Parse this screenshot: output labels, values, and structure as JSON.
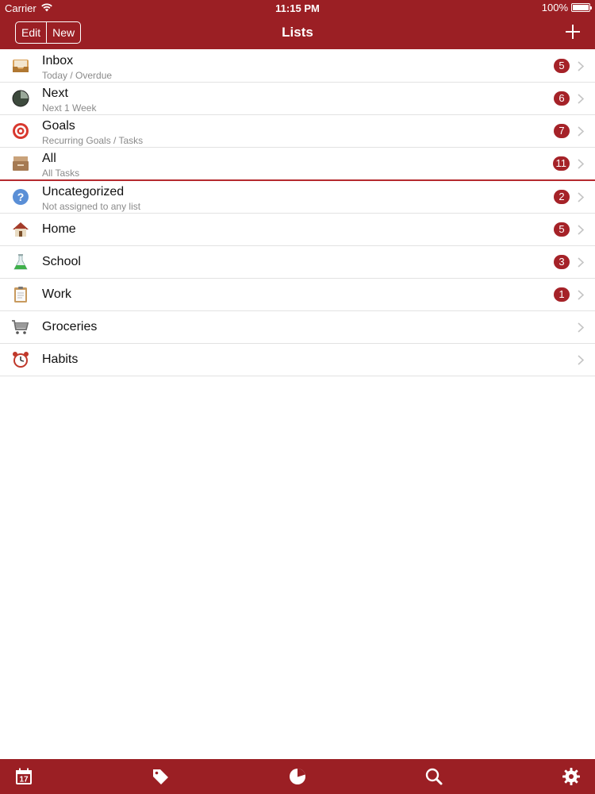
{
  "status_bar": {
    "carrier": "Carrier",
    "time": "11:15 PM",
    "battery": "100%"
  },
  "nav": {
    "edit_label": "Edit",
    "new_label": "New",
    "title": "Lists",
    "add_icon": "plus-icon"
  },
  "lists": [
    {
      "title": "Inbox",
      "subtitle": "Today / Overdue",
      "badge": "5",
      "icon": "inbox-tray-icon"
    },
    {
      "title": "Next",
      "subtitle": "Next 1 Week",
      "badge": "6",
      "icon": "clock-pie-icon"
    },
    {
      "title": "Goals",
      "subtitle": "Recurring Goals / Tasks",
      "badge": "7",
      "icon": "target-icon"
    },
    {
      "title": "All",
      "subtitle": "All Tasks",
      "badge": "11",
      "icon": "archive-box-icon"
    },
    {
      "title": "Uncategorized",
      "subtitle": "Not assigned to any list",
      "badge": "2",
      "icon": "question-icon"
    },
    {
      "title": "Home",
      "subtitle": "",
      "badge": "5",
      "icon": "house-icon"
    },
    {
      "title": "School",
      "subtitle": "",
      "badge": "3",
      "icon": "flask-icon"
    },
    {
      "title": "Work",
      "subtitle": "",
      "badge": "1",
      "icon": "clipboard-icon"
    },
    {
      "title": "Groceries",
      "subtitle": "",
      "badge": "",
      "icon": "cart-icon"
    },
    {
      "title": "Habits",
      "subtitle": "",
      "badge": "",
      "icon": "alarm-clock-icon"
    }
  ],
  "tabbar": {
    "calendar_day": "17",
    "items": [
      "calendar-icon",
      "tag-icon",
      "pie-chart-icon",
      "search-icon",
      "gear-icon"
    ]
  },
  "colors": {
    "brand_red": "#9b1f24",
    "badge_red": "#a52228",
    "subtitle_gray": "#8a8a8a"
  }
}
